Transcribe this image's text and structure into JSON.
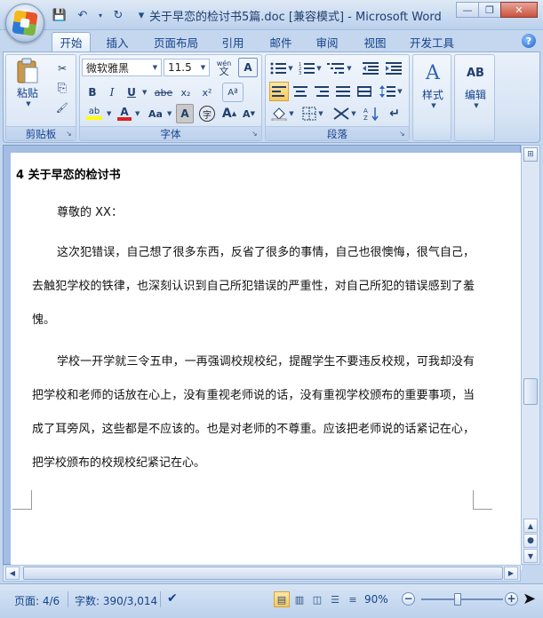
{
  "window": {
    "title": "关于早恋的检讨书5篇.doc [兼容模式] - Microsoft Word",
    "minimize_glyph": "—",
    "restore_glyph": "❐",
    "close_glyph": "✕"
  },
  "qat": {
    "save_glyph": "💾",
    "undo_glyph": "↶",
    "redo_glyph": "↻",
    "customize_glyph": "▾"
  },
  "tabs": [
    "开始",
    "插入",
    "页面布局",
    "引用",
    "邮件",
    "审阅",
    "视图",
    "开发工具"
  ],
  "active_tab": "开始",
  "ribbon": {
    "clipboard": {
      "label": "剪贴板",
      "paste_label": "粘贴",
      "cut_glyph": "✂",
      "copy_glyph": "⎘",
      "format_painter_glyph": "🖌"
    },
    "font": {
      "label": "字体",
      "font_name": "微软雅黑",
      "font_size": "11.5",
      "phonetic_glyph": "wén",
      "char_border_glyph": "A",
      "bold": "B",
      "italic": "I",
      "underline": "U",
      "strikethrough": "abe",
      "subscript": "x₂",
      "superscript": "x²",
      "clear_format_glyph": "Aª",
      "highlight_glyph": "ab",
      "font_color_glyph": "A",
      "case_glyph": "Aa",
      "char_shading_glyph": "A",
      "enclose_glyph": "字",
      "grow_glyph": "A",
      "shrink_glyph": "A"
    },
    "paragraph": {
      "label": "段落"
    },
    "styles": {
      "label": "样式",
      "glyph": "A"
    },
    "editing": {
      "label": "编辑",
      "glyph": "AB"
    },
    "colors": {
      "highlight": "#ffff00",
      "font_color": "#e02020"
    }
  },
  "document": {
    "heading": "4 关于早恋的检讨书",
    "greeting": "尊敬的 XX：",
    "paragraphs": [
      "这次犯错误，自己想了很多东西，反省了很多的事情，自己也很懊悔，很气自己，去触犯学校的铁律，也深刻认识到自己所犯错误的严重性，对自己所犯的错误感到了羞愧。",
      "学校一开学就三令五申，一再强调校规校纪，提醒学生不要违反校规，可我却没有把学校和老师的话放在心上，没有重视老师说的话，没有重视学校颁布的重要事项，当成了耳旁风，这些都是不应该的。也是对老师的不尊重。应该把老师说的话紧记在心，把学校颁布的校规校纪紧记在心。"
    ]
  },
  "status": {
    "page": "页面: 4/6",
    "words": "字数: 390/3,014",
    "zoom": "90%",
    "zoom_fraction": 0.9
  }
}
